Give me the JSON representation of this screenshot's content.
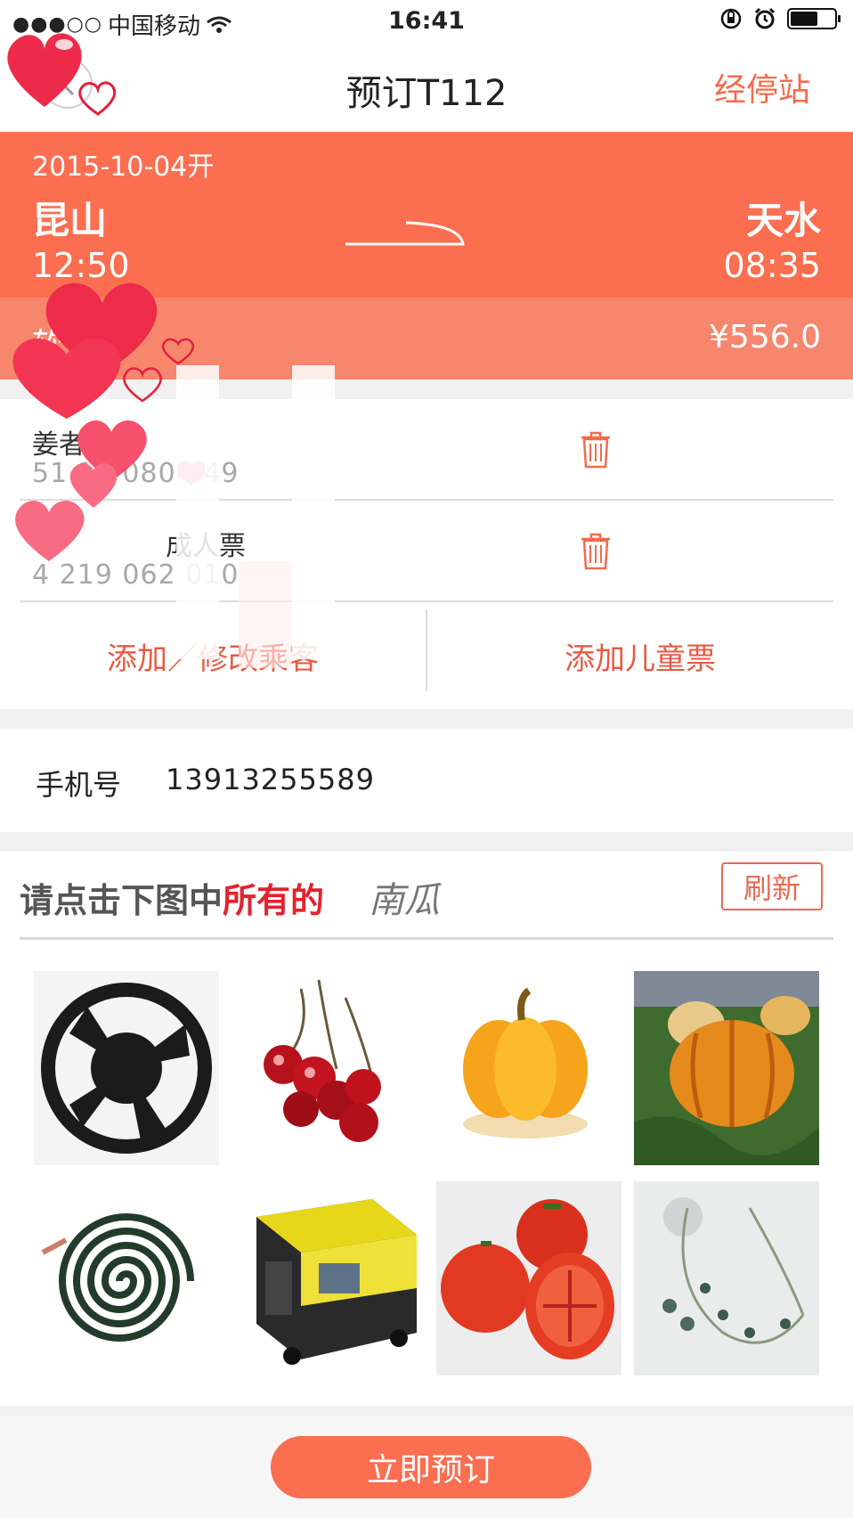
{
  "status_bar": {
    "signal": "●●●○○",
    "carrier": "中国移动",
    "time": "16:41"
  },
  "nav": {
    "title": "预订T112",
    "right_link": "经停站"
  },
  "trip": {
    "date": "2015-10-04开",
    "from_station": "昆山",
    "to_station": "天水",
    "departure_time": "12:50",
    "arrival_time": "08:35"
  },
  "seat": {
    "type": "软",
    "price": "¥556.0"
  },
  "passengers": [
    {
      "name": "姜者",
      "id_number": "51 19 0804 49"
    },
    {
      "name": "成人票",
      "id_number": "4 219 062 010"
    }
  ],
  "passenger_actions": {
    "add_modify": "添加／修改乘客",
    "add_child": "添加儿童票"
  },
  "contact": {
    "label": "手机号",
    "value": "13913255589"
  },
  "captcha": {
    "prompt_plain": "请点击下图中",
    "prompt_highlight": "所有的",
    "target_word": "南瓜",
    "refresh_label": "刷新",
    "tiles": [
      "fan",
      "cherries",
      "pumpkin",
      "pumpkin-field",
      "mosquito-coil",
      "generator",
      "tomatoes",
      "necklace"
    ]
  },
  "footer": {
    "book_label": "立即预订"
  },
  "colors": {
    "accent": "#fb6e50",
    "seat_bar": "#f6876d",
    "action_text": "#e55b45",
    "captcha_red": "#e2232e"
  }
}
